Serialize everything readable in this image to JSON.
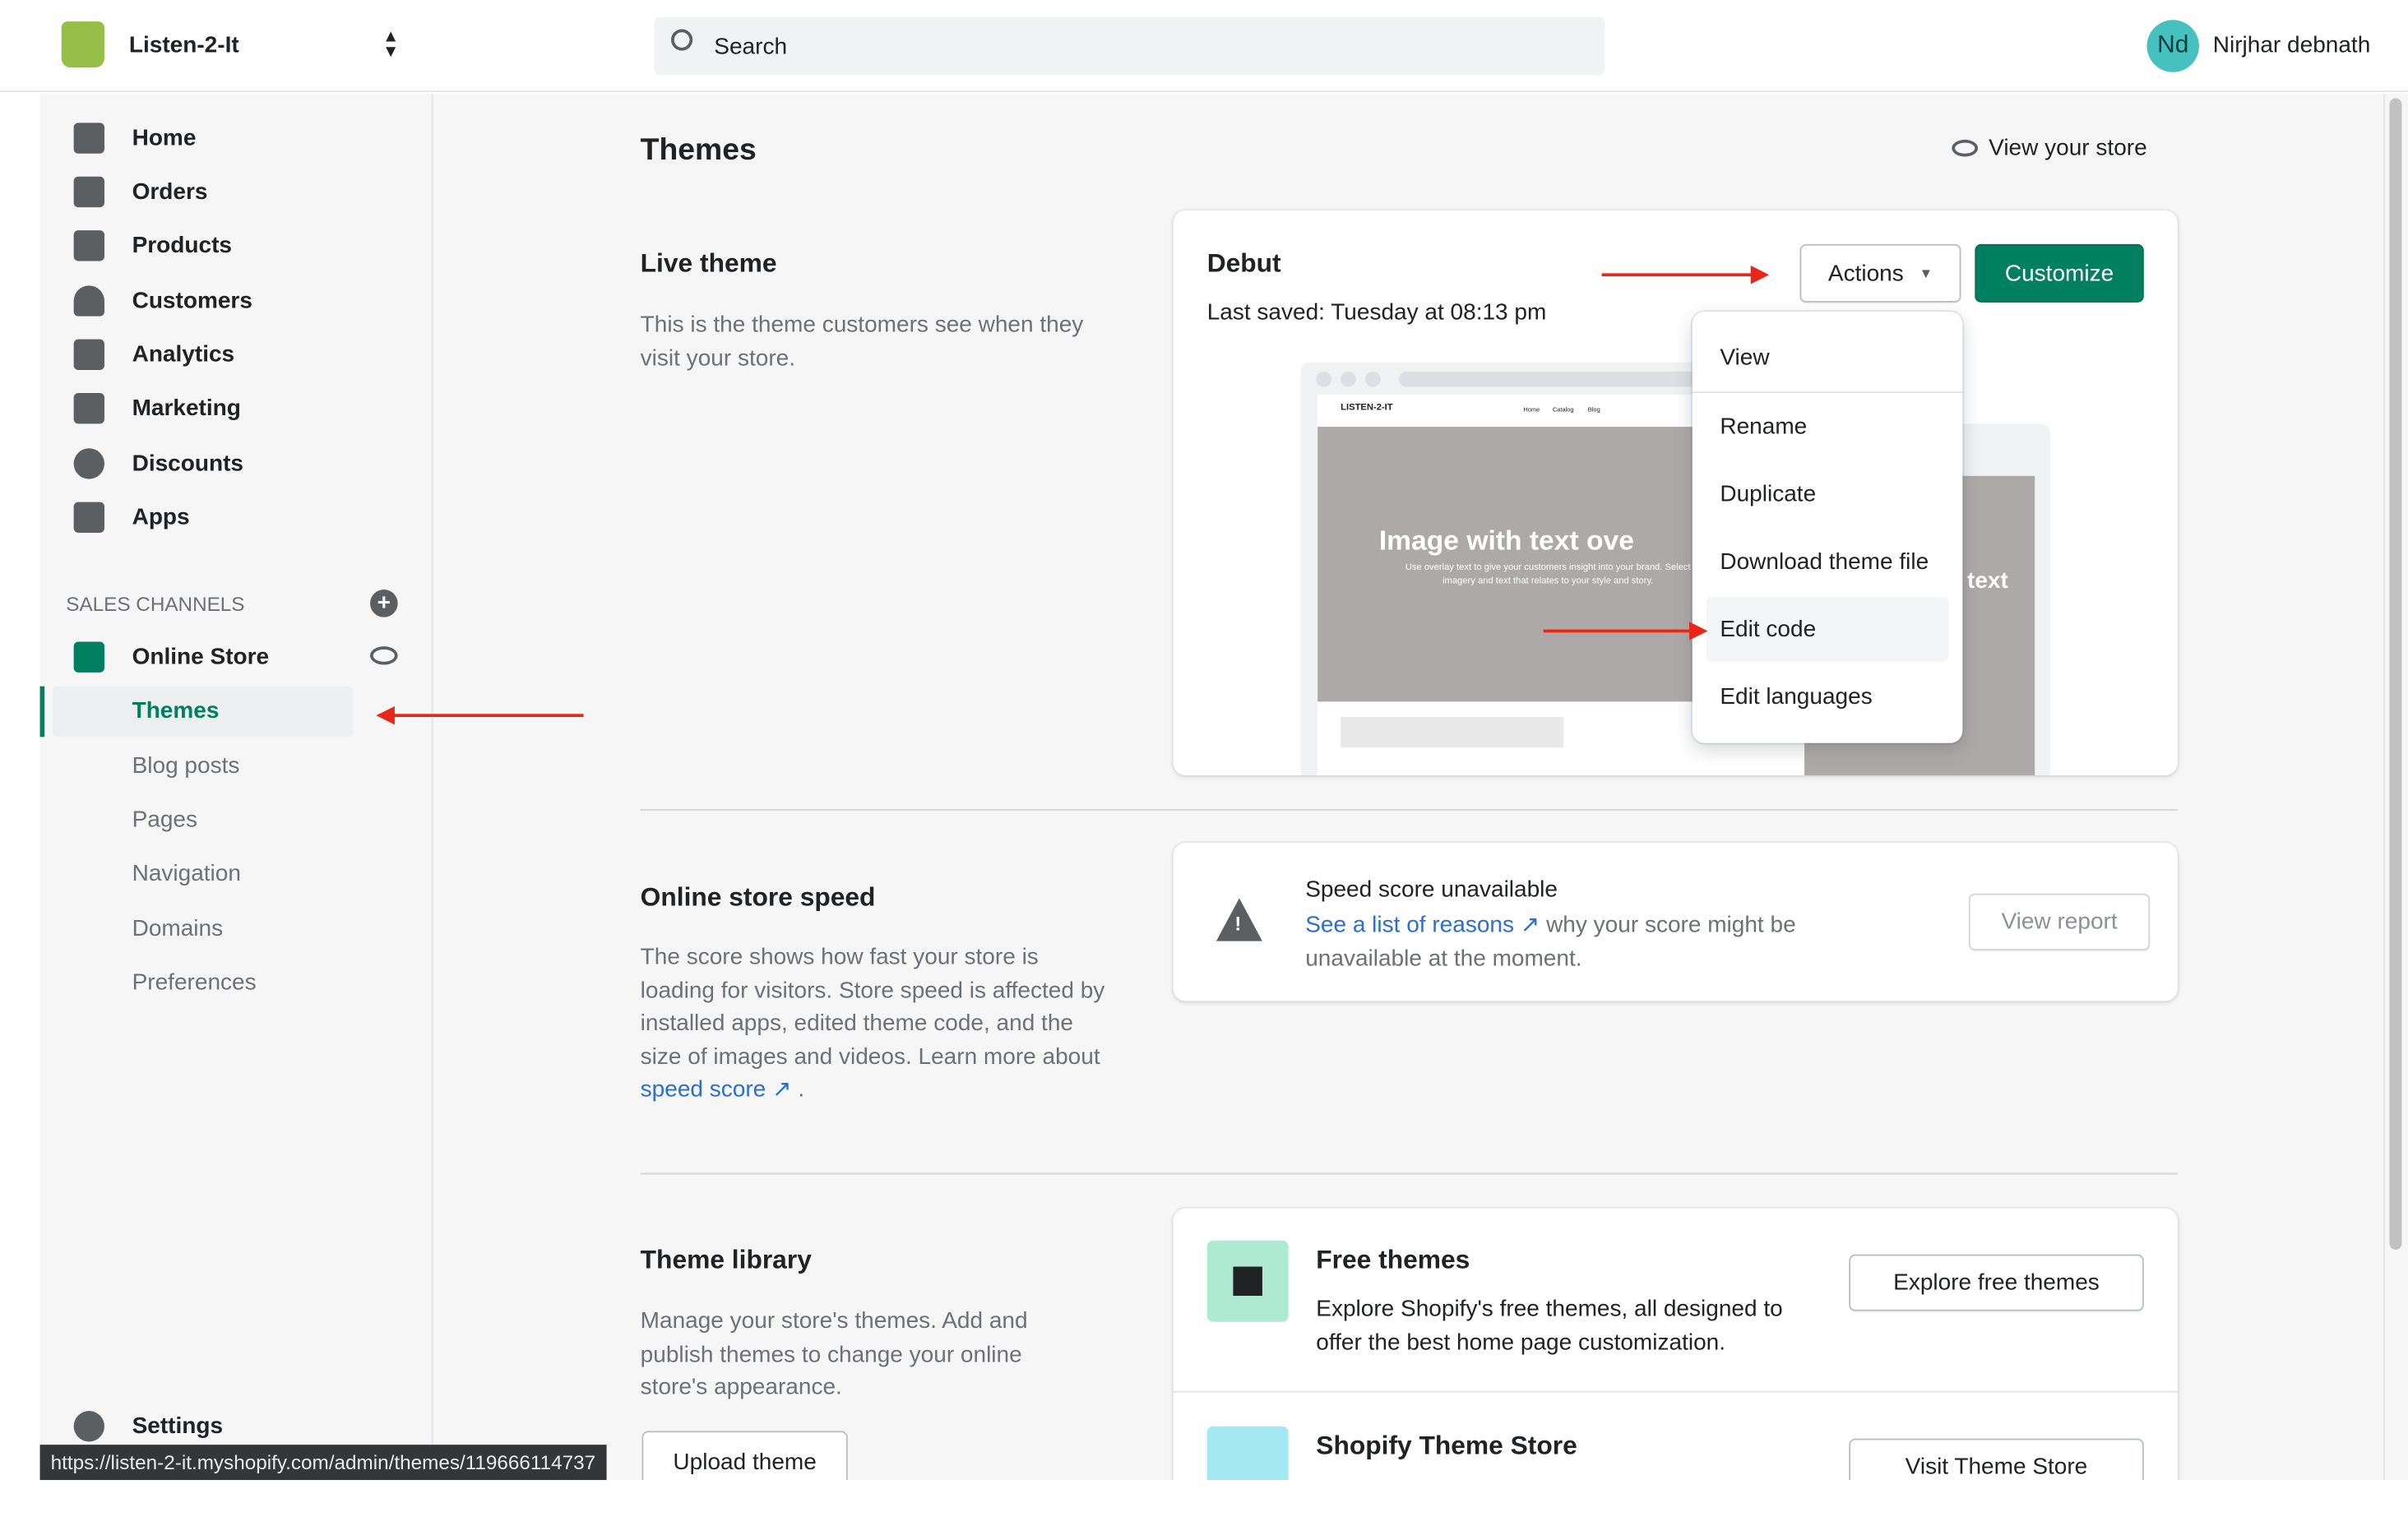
{
  "header": {
    "store_name": "Listen-2-It",
    "search_placeholder": "Search",
    "avatar_initials": "Nd",
    "user_name": "Nirjhar debnath"
  },
  "sidebar": {
    "items": [
      {
        "label": "Home",
        "icon": "home-icon"
      },
      {
        "label": "Orders",
        "icon": "orders-icon"
      },
      {
        "label": "Products",
        "icon": "tag-icon"
      },
      {
        "label": "Customers",
        "icon": "person-icon"
      },
      {
        "label": "Analytics",
        "icon": "bar-chart-icon"
      },
      {
        "label": "Marketing",
        "icon": "megaphone-icon"
      },
      {
        "label": "Discounts",
        "icon": "discount-icon"
      },
      {
        "label": "Apps",
        "icon": "apps-icon"
      }
    ],
    "sales_channels_label": "SALES CHANNELS",
    "online_store": "Online Store",
    "sub_items": [
      "Themes",
      "Blog posts",
      "Pages",
      "Navigation",
      "Domains",
      "Preferences"
    ],
    "active_sub": "Themes",
    "settings": "Settings"
  },
  "status_url": "https://listen-2-it.myshopify.com/admin/themes/119666114737",
  "page": {
    "title": "Themes",
    "view_store": "View your store"
  },
  "live_theme": {
    "heading": "Live theme",
    "description": "This is the theme customers see when they visit your store.",
    "theme_name": "Debut",
    "last_saved": "Last saved: Tuesday at 08:13 pm",
    "actions_label": "Actions",
    "customize_label": "Customize",
    "preview": {
      "store_logo": "LISTEN-2-IT",
      "nav": [
        "Home",
        "Catalog",
        "Blog"
      ],
      "hero_title": "Image with text ove",
      "hero_text": "Use overlay text to give your customers insight into your brand. Select imagery and text that relates to your style and story.",
      "mobile_title": "text"
    },
    "menu": [
      "View",
      "Rename",
      "Duplicate",
      "Download theme file",
      "Edit code",
      "Edit languages"
    ],
    "menu_highlighted": "Edit code"
  },
  "speed": {
    "heading": "Online store speed",
    "description": "The score shows how fast your store is loading for visitors. Store speed is affected by installed apps, edited theme code, and the size of images and videos. Learn more about",
    "description_link": "speed score",
    "period": ".",
    "status": "Speed score unavailable",
    "link": "See a list of reasons",
    "rest": "why your score might be unavailable at the moment.",
    "view_report": "View report"
  },
  "library": {
    "heading": "Theme library",
    "description": "Manage your store's themes. Add and publish themes to change your online store's appearance.",
    "upload": "Upload theme",
    "free_title": "Free themes",
    "free_desc": "Explore Shopify's free themes, all designed to offer the best home page customization.",
    "free_button": "Explore free themes",
    "store_title": "Shopify Theme Store",
    "store_button": "Visit Theme Store"
  },
  "colors": {
    "primary": "#008060",
    "arrow": "#e8261a",
    "link": "#2c6ecb"
  }
}
